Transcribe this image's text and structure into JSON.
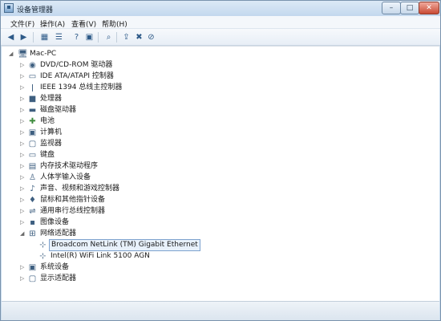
{
  "window": {
    "title": "设备管理器",
    "controls": {
      "minimize": "–",
      "maximize": "□",
      "close": "✕"
    }
  },
  "menu": [
    "文件(F)",
    "操作(A)",
    "查看(V)",
    "帮助(H)"
  ],
  "toolbar_icons": [
    "back-arrow-icon",
    "forward-arrow-icon",
    "properties-icon",
    "list-icon",
    "help-icon",
    "view-icon",
    "scan-hardware-icon",
    "update-driver-icon",
    "uninstall-icon",
    "disable-icon"
  ],
  "tree": {
    "root": "Mac-PC",
    "items": [
      {
        "label": "DVD/CD-ROM 驱动器",
        "icon": "disc-drive-icon",
        "expanded": false
      },
      {
        "label": "IDE ATA/ATAPI 控制器",
        "icon": "ide-controller-icon",
        "expanded": false
      },
      {
        "label": "IEEE 1394 总线主控制器",
        "icon": "firewire-icon",
        "expanded": false
      },
      {
        "label": "处理器",
        "icon": "processor-icon",
        "expanded": false
      },
      {
        "label": "磁盘驱动器",
        "icon": "disk-drive-icon",
        "expanded": false
      },
      {
        "label": "电池",
        "icon": "battery-icon",
        "expanded": false
      },
      {
        "label": "计算机",
        "icon": "computer-icon",
        "expanded": false
      },
      {
        "label": "监视器",
        "icon": "monitor-icon",
        "expanded": false
      },
      {
        "label": "键盘",
        "icon": "keyboard-icon",
        "expanded": false
      },
      {
        "label": "内存技术驱动程序",
        "icon": "memory-icon",
        "expanded": false
      },
      {
        "label": "人体学输入设备",
        "icon": "hid-icon",
        "expanded": false
      },
      {
        "label": "声音、视频和游戏控制器",
        "icon": "sound-icon",
        "expanded": false
      },
      {
        "label": "鼠标和其他指针设备",
        "icon": "mouse-icon",
        "expanded": false
      },
      {
        "label": "通用串行总线控制器",
        "icon": "usb-icon",
        "expanded": false
      },
      {
        "label": "图像设备",
        "icon": "camera-icon",
        "expanded": false
      },
      {
        "label": "网络适配器",
        "icon": "network-adapter-icon",
        "expanded": true,
        "children": [
          {
            "label": "Broadcom NetLink (TM) Gigabit Ethernet",
            "icon": "network-card-icon",
            "selected": true
          },
          {
            "label": "Intel(R) WiFi Link 5100 AGN",
            "icon": "network-card-icon",
            "selected": false
          }
        ]
      },
      {
        "label": "系统设备",
        "icon": "system-device-icon",
        "expanded": false
      },
      {
        "label": "显示适配器",
        "icon": "display-adapter-icon",
        "expanded": false
      }
    ]
  }
}
